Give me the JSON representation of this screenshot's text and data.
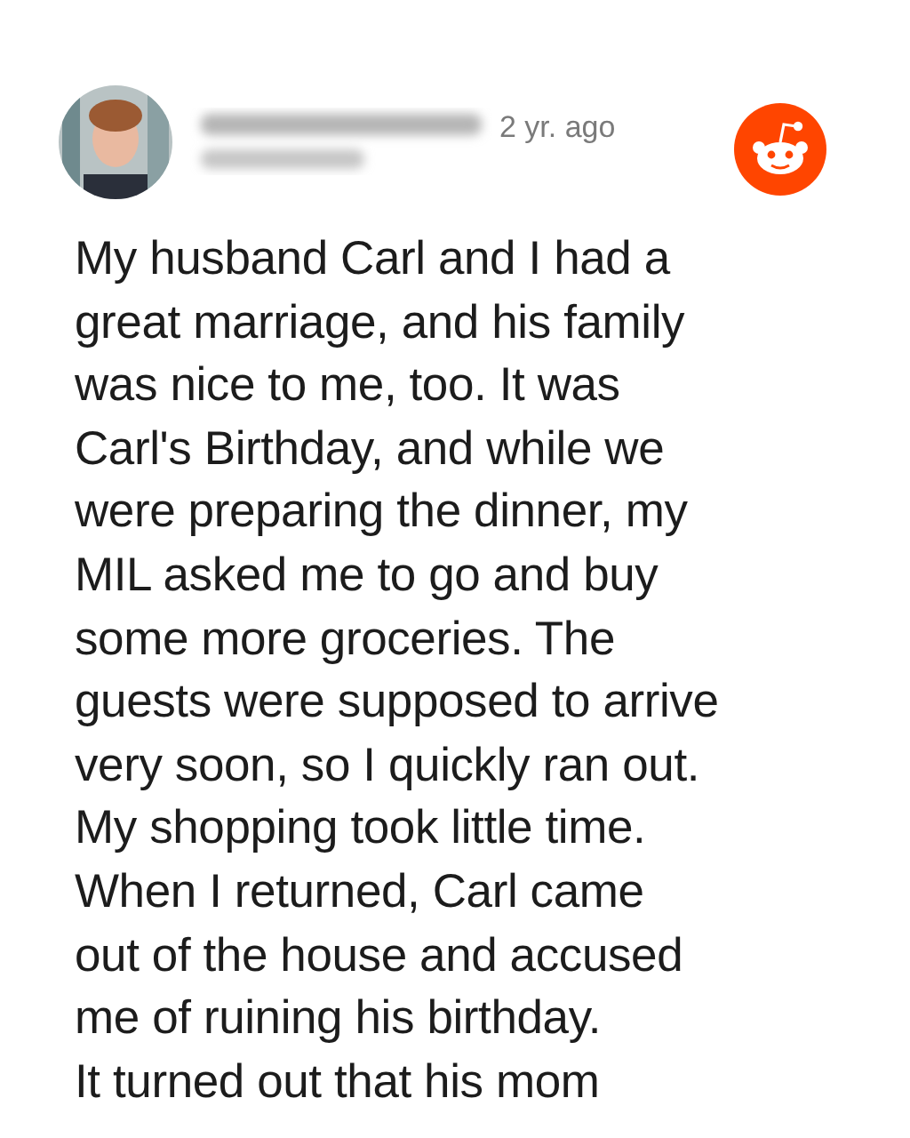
{
  "post": {
    "time": "2 yr. ago",
    "lines": [
      "My husband Carl and I had a",
      "great marriage, and his family",
      "was nice to me, too. It was",
      "Carl's Birthday, and while we",
      "were preparing the dinner, my",
      "MIL asked me to go and buy",
      "some more groceries. The",
      "guests were supposed to arrive",
      "very soon, so I quickly ran out.",
      "My shopping took little time.",
      "When I returned, Carl came",
      "out of the house and accused",
      "me of ruining his birthday.",
      "It turned out that his mom"
    ]
  }
}
